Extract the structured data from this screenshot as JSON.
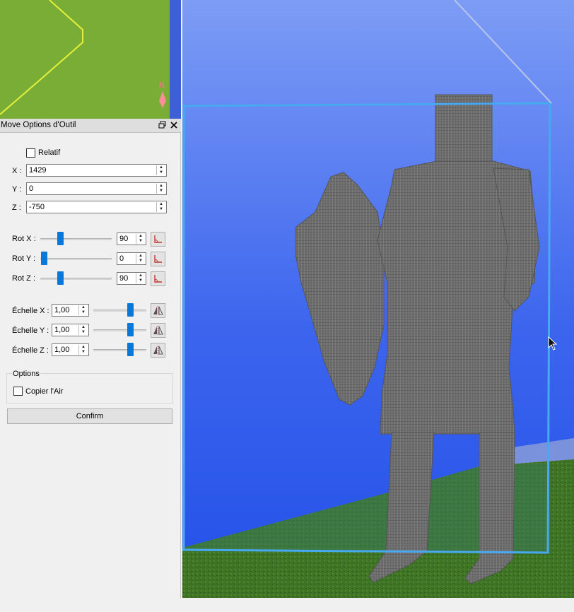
{
  "minimap": {
    "compass_letter": "N",
    "colors": {
      "ground": "#79ad35",
      "water": "#3e60d6",
      "outline": "#e2f03c"
    }
  },
  "panel": {
    "title": "Move Options d'Outil",
    "restore_icon": "restore-icon",
    "close_icon": "close-icon",
    "relatif": {
      "label": "Relatif",
      "checked": false
    },
    "position": {
      "x": {
        "label": "X :",
        "value": "1429"
      },
      "y": {
        "label": "Y :",
        "value": "0"
      },
      "z": {
        "label": "Z :",
        "value": "-750"
      }
    },
    "rotation": {
      "x": {
        "label": "Rot X :",
        "value": "90",
        "slider_fraction": 0.25
      },
      "y": {
        "label": "Rot Y :",
        "value": "0",
        "slider_fraction": 0.0
      },
      "z": {
        "label": "Rot Z :",
        "value": "90",
        "slider_fraction": 0.25
      }
    },
    "scale": {
      "x": {
        "label": "Échelle X :",
        "value": "1,00",
        "slider_fraction": 0.66
      },
      "y": {
        "label": "Échelle Y :",
        "value": "1,00",
        "slider_fraction": 0.66
      },
      "z": {
        "label": "Échelle Z :",
        "value": "1,00",
        "slider_fraction": 0.66
      }
    },
    "options": {
      "group_label": "Options",
      "copy_air": {
        "label": "Copier l'Air",
        "checked": false
      }
    },
    "confirm_label": "Confirm",
    "colors": {
      "accent": "#0a78d7"
    }
  },
  "viewport": {
    "colors": {
      "sky_top": "#7d9cf5",
      "sky_bottom": "#2350e8",
      "selection_box": "#48a8f0",
      "model": "#6b6b6b",
      "grass": "#3d6e24"
    }
  }
}
